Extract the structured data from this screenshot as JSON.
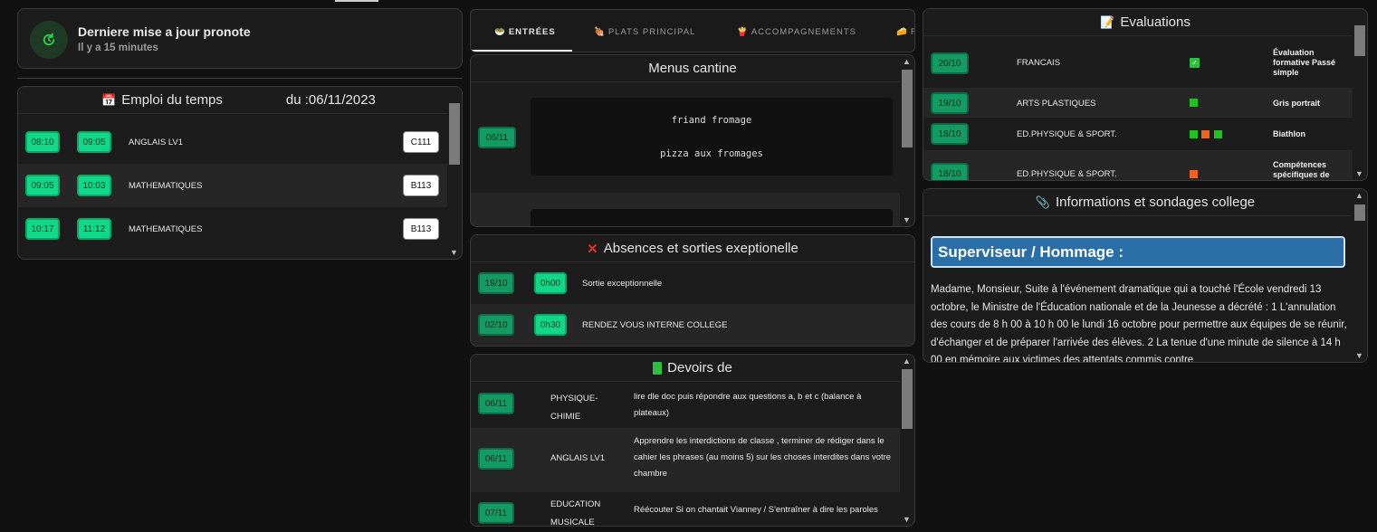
{
  "update": {
    "title": "Derniere mise a jour pronote",
    "subtitle": "Il y a 15 minutes"
  },
  "timetable": {
    "title": "Emploi du temps",
    "date_label": "du :06/11/2023",
    "rows": [
      {
        "start": "08:10",
        "end": "09:05",
        "subject": "ANGLAIS LV1",
        "room": "C111"
      },
      {
        "start": "09:05",
        "end": "10:03",
        "subject": "MATHEMATIQUES",
        "room": "B113"
      },
      {
        "start": "10:17",
        "end": "11:12",
        "subject": "MATHEMATIQUES",
        "room": "B113"
      }
    ]
  },
  "tabs": [
    "ENTRÉES",
    "PLATS PRINCIPAL",
    "ACCOMPAGNEMENTS",
    "F"
  ],
  "menus": {
    "title": "Menus cantine",
    "date": "06/11",
    "items": [
      "friand fromage",
      "pizza aux fromages"
    ]
  },
  "absences": {
    "title": "Absences et sorties exeptionelle",
    "rows": [
      {
        "date": "19/10",
        "duration": "0h00",
        "label": "Sortie exceptionnelle"
      },
      {
        "date": "02/10",
        "duration": "0h30",
        "label": "RENDEZ VOUS INTERNE COLLEGE"
      }
    ]
  },
  "homework": {
    "title": "Devoirs de",
    "rows": [
      {
        "date": "06/11",
        "subject": "PHYSIQUE-CHIMIE",
        "text": "lire dle doc puis répondre aux questions a, b et c (balance à plateaux)"
      },
      {
        "date": "06/11",
        "subject": "ANGLAIS LV1",
        "text": "Apprendre les interdictions de classe , terminer de rédiger dans le cahier les phrases (au moins 5) sur les choses interdites dans votre chambre"
      },
      {
        "date": "07/11",
        "subject": "EDUCATION MUSICALE",
        "text": "Réécouter Si on chantait Vianney / S'entraîner à dire les paroles"
      }
    ]
  },
  "evaluations": {
    "title": "Evaluations",
    "rows": [
      {
        "date": "20/10",
        "subject": "FRANCAIS",
        "marks": [
          "check"
        ],
        "label": "Évaluation formative Passé simple"
      },
      {
        "date": "19/10",
        "subject": "ARTS PLASTIQUES",
        "marks": [
          "green"
        ],
        "label": "Gris portrait"
      },
      {
        "date": "18/10",
        "subject": "ED.PHYSIQUE & SPORT.",
        "marks": [
          "green",
          "orange",
          "green"
        ],
        "label": "Biathlon"
      },
      {
        "date": "18/10",
        "subject": "ED.PHYSIQUE & SPORT.",
        "marks": [
          "orange"
        ],
        "label": "Compétences spécifiques de"
      }
    ]
  },
  "info": {
    "title": "Informations et sondages college",
    "heading": "Superviseur / Hommage :",
    "body": "Madame, Monsieur,    Suite à l'événement dramatique qui a touché l'École vendredi 13 octobre, le Ministre de l'Éducation nationale et de la Jeunesse a décrété :    1 L'annulation des cours de 8 h 00 à 10 h 00 le lundi 16 octobre pour permettre aux équipes de se réunir, d'échanger et de préparer l'arrivée des élèves.    2 La tenue d'une minute de silence à 14 h 00 en mémoire aux victimes des attentats commis contre"
  },
  "colors": {
    "accent_green": "#11d889",
    "dark_green": "#149b63",
    "mark_green": "#1fc21f",
    "mark_orange": "#f0621e",
    "info_heading_bg": "#2a6ea8"
  },
  "icons": {
    "refresh": "refresh-icon",
    "calendar": "calendar-icon",
    "cross": "cross-icon",
    "book": "book-icon",
    "memo": "memo-icon",
    "pin": "pin-icon"
  }
}
